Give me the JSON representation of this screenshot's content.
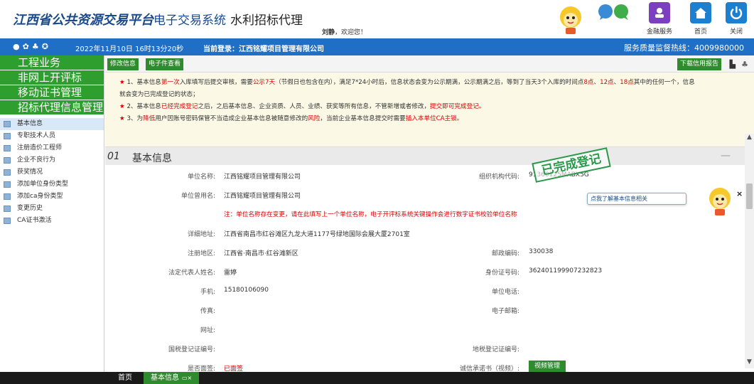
{
  "header": {
    "brand_main": "江西省公共资源交易平台",
    "brand_sub": "电子交易系统",
    "brand_module": "水利招标代理",
    "welcome_user": "刘静",
    "welcome_text": "，欢迎您！",
    "btn_finance": "金融服务",
    "btn_home": "首页",
    "btn_close": "关闭"
  },
  "bar": {
    "datetime": "2022年11月10日 16时13分20秒",
    "login_label": "当前登录：江西铭耀项目管理有限公司",
    "hotline": "服务质量监督热线：4009980000"
  },
  "sidebar": {
    "main_menu": [
      "工程业务",
      "非网上开评标",
      "移动证书管理",
      "招标代理信息管理"
    ],
    "items": [
      {
        "label": "基本信息"
      },
      {
        "label": "专职技术人员"
      },
      {
        "label": "注册造价工程师"
      },
      {
        "label": "企业不良行为"
      },
      {
        "label": "获奖情况"
      },
      {
        "label": "添加单位身份类型"
      },
      {
        "label": "添加ca身份类型"
      },
      {
        "label": "变更历史"
      },
      {
        "label": "CA证书激活"
      }
    ]
  },
  "toolbar": {
    "edit_label": "修改信息",
    "files_label": "电子件查看",
    "credit_label": "下载信用报告"
  },
  "notice": {
    "l1_a": "★",
    "l1_b": " 1、基本信息",
    "l1_c": "第一次",
    "l1_d": "入库填写后提交审核，需要",
    "l1_e": "公示7天",
    "l1_f": "（节假日也包含在内），满足7*24小时后，信息状态会变为公示期满，公示期满之后，等到了当天3个入库的时间点",
    "l1_g": "8点",
    "l1_h": "、",
    "l1_i": "12点",
    "l1_j": "、",
    "l1_k": "18点",
    "l1_l": "其中的任何一个，信息",
    "l1_m": "就会变为已完成登记的状态；",
    "l2_a": "★",
    "l2_b": " 2、基本信息",
    "l2_c": "已经完成登记",
    "l2_d": "之后，之后基本信息、企业资质、人员、业绩、获奖等所有信息，不管新增或者修改，",
    "l2_e": "提交即可完成登记。",
    "l3_a": "★",
    "l3_b": " 3、为",
    "l3_c": "降低",
    "l3_d": "用户因账号密码保管不当造成企业基本信息被随意修改的",
    "l3_e": "风险",
    "l3_f": "，当前企业基本信息提交时需要",
    "l3_g": "插入本单位CA主锁。"
  },
  "section": {
    "number": "01",
    "title": "基本信息",
    "collapse": "—",
    "stamp": "已完成登记",
    "tip": "点我了解基本信息相关",
    "close": "×"
  },
  "fields": {
    "unit_name_label": "单位名称:",
    "unit_name": "江西铭耀项目管理有限公司",
    "org_code_label": "组织机构代码:",
    "org_code": "91360125MABX5G",
    "used_name_label": "单位曾用名:",
    "used_name": "江西铭耀项目管理有限公司",
    "warning": "注：单位名称存在变更，请在此填写上一个单位名称，电子开评标系统关键操作会进行数字证书校验单位名称",
    "address_label": "详细地址:",
    "address": "江西省南昌市红谷滩区九龙大道1177号绿地国际会展大厦2701室",
    "region_label": "注册地区:",
    "region": "江西省·南昌市·红谷滩新区",
    "postcode_label": "邮政编码:",
    "postcode": "330038",
    "legal_label": "法定代表人姓名:",
    "legal": "雷婷",
    "idcard_label": "身份证号码:",
    "idcard": "362401199907232823",
    "mobile_label": "手机:",
    "mobile": "15180106090",
    "unit_phone_label": "单位电话:",
    "fax_label": "传真:",
    "email_label": "电子邮箱:",
    "website_label": "网址:",
    "national_tax_label": "国税登记证编号:",
    "local_tax_label": "地税登记证编号:",
    "signed_label": "是否面签:",
    "signed": "已面签",
    "promise_label": "诚信承诺书（视频）:",
    "video_btn": "视频管理"
  },
  "tabs": {
    "home": "首页",
    "basic": "基本信息"
  }
}
